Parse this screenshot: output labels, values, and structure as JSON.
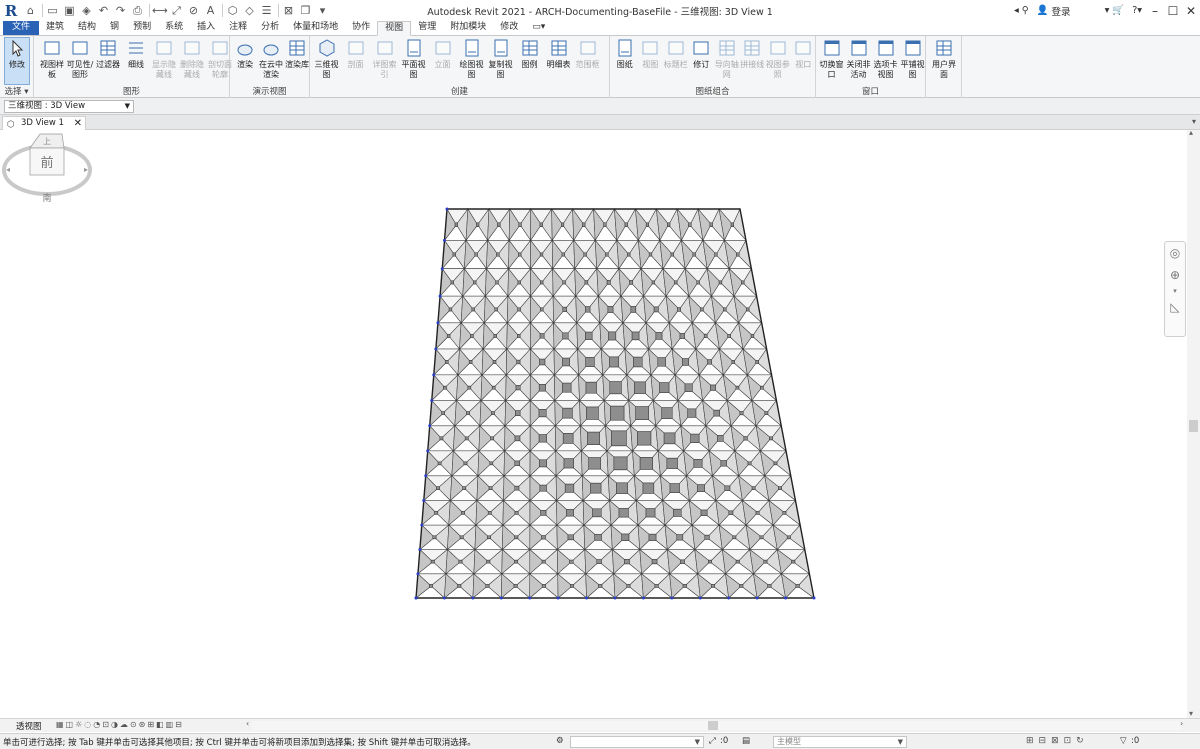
{
  "app": {
    "title": "Autodesk Revit 2021 - ARCH-Documenting-BaseFile - 三维视图: 3D View 1",
    "logo": "R",
    "sign_in_label": "登录"
  },
  "ribbon": {
    "tabs": [
      {
        "label": "文件",
        "state": "file"
      },
      {
        "label": "建筑"
      },
      {
        "label": "结构"
      },
      {
        "label": "钢"
      },
      {
        "label": "预制"
      },
      {
        "label": "系统"
      },
      {
        "label": "插入"
      },
      {
        "label": "注释"
      },
      {
        "label": "分析"
      },
      {
        "label": "体量和场地"
      },
      {
        "label": "协作"
      },
      {
        "label": "视图",
        "state": "active"
      },
      {
        "label": "管理"
      },
      {
        "label": "附加模块"
      },
      {
        "label": "修改"
      }
    ],
    "panels": {
      "select": {
        "title": "选择",
        "modify": "修改"
      },
      "graphics": {
        "title": "图形",
        "buttons": [
          "视图样板",
          "可见性/图形",
          "过滤器",
          "细线",
          "显示隐藏线",
          "删除隐藏线",
          "剖切面轮廓"
        ]
      },
      "presentation": {
        "title": "演示视图",
        "buttons": [
          "渲染",
          "在云中渲染",
          "渲染库"
        ]
      },
      "create": {
        "title": "创建",
        "buttons": [
          "三维视图",
          "剖面",
          "详图索引",
          "平面视图",
          "立面",
          "绘图视图",
          "复制视图",
          "图例",
          "明细表",
          "范围框"
        ]
      },
      "sheet": {
        "title": "图纸组合",
        "buttons": [
          "图纸",
          "视图",
          "标题栏",
          "修订",
          "导向轴网",
          "拼接线",
          "视图参照",
          "视口"
        ]
      },
      "window": {
        "title": "窗口",
        "buttons": [
          "切换窗口",
          "关闭非活动",
          "选项卡视图",
          "平铺视图"
        ]
      },
      "ui": {
        "buttons": [
          "用户界面"
        ]
      }
    }
  },
  "options_bar": {
    "type_selector": "三维视图 : 3D View"
  },
  "view_tab": {
    "label": "3D View 1"
  },
  "viewcube": {
    "face_top": "上",
    "face_front": "前",
    "compass_south": "南"
  },
  "view_control": {
    "projection": "透视图"
  },
  "status_bar": {
    "message": "单击可进行选择; 按 Tab 键并单击可选择其他项目; 按 Ctrl 键并单击可将新项目添加到选择集; 按 Shift 键并单击可取消选择。",
    "workset_value": ":0",
    "model_field": "主模型",
    "filter_count": ":0"
  }
}
